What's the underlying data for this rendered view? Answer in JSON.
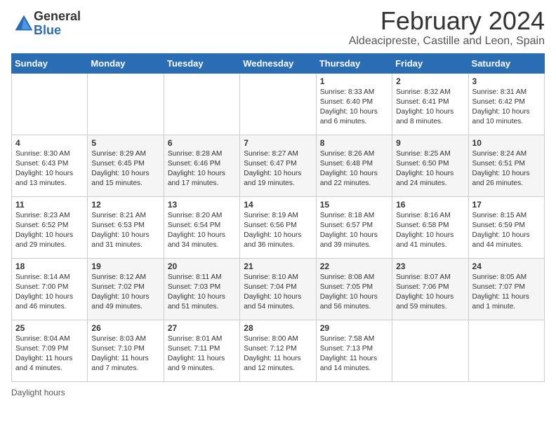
{
  "logo": {
    "general": "General",
    "blue": "Blue"
  },
  "title": {
    "month": "February 2024",
    "location": "Aldeacipreste, Castille and Leon, Spain"
  },
  "days_header": [
    "Sunday",
    "Monday",
    "Tuesday",
    "Wednesday",
    "Thursday",
    "Friday",
    "Saturday"
  ],
  "weeks": [
    [
      {
        "day": "",
        "info": ""
      },
      {
        "day": "",
        "info": ""
      },
      {
        "day": "",
        "info": ""
      },
      {
        "day": "",
        "info": ""
      },
      {
        "day": "1",
        "info": "Sunrise: 8:33 AM\nSunset: 6:40 PM\nDaylight: 10 hours\nand 6 minutes."
      },
      {
        "day": "2",
        "info": "Sunrise: 8:32 AM\nSunset: 6:41 PM\nDaylight: 10 hours\nand 8 minutes."
      },
      {
        "day": "3",
        "info": "Sunrise: 8:31 AM\nSunset: 6:42 PM\nDaylight: 10 hours\nand 10 minutes."
      }
    ],
    [
      {
        "day": "4",
        "info": "Sunrise: 8:30 AM\nSunset: 6:43 PM\nDaylight: 10 hours\nand 13 minutes."
      },
      {
        "day": "5",
        "info": "Sunrise: 8:29 AM\nSunset: 6:45 PM\nDaylight: 10 hours\nand 15 minutes."
      },
      {
        "day": "6",
        "info": "Sunrise: 8:28 AM\nSunset: 6:46 PM\nDaylight: 10 hours\nand 17 minutes."
      },
      {
        "day": "7",
        "info": "Sunrise: 8:27 AM\nSunset: 6:47 PM\nDaylight: 10 hours\nand 19 minutes."
      },
      {
        "day": "8",
        "info": "Sunrise: 8:26 AM\nSunset: 6:48 PM\nDaylight: 10 hours\nand 22 minutes."
      },
      {
        "day": "9",
        "info": "Sunrise: 8:25 AM\nSunset: 6:50 PM\nDaylight: 10 hours\nand 24 minutes."
      },
      {
        "day": "10",
        "info": "Sunrise: 8:24 AM\nSunset: 6:51 PM\nDaylight: 10 hours\nand 26 minutes."
      }
    ],
    [
      {
        "day": "11",
        "info": "Sunrise: 8:23 AM\nSunset: 6:52 PM\nDaylight: 10 hours\nand 29 minutes."
      },
      {
        "day": "12",
        "info": "Sunrise: 8:21 AM\nSunset: 6:53 PM\nDaylight: 10 hours\nand 31 minutes."
      },
      {
        "day": "13",
        "info": "Sunrise: 8:20 AM\nSunset: 6:54 PM\nDaylight: 10 hours\nand 34 minutes."
      },
      {
        "day": "14",
        "info": "Sunrise: 8:19 AM\nSunset: 6:56 PM\nDaylight: 10 hours\nand 36 minutes."
      },
      {
        "day": "15",
        "info": "Sunrise: 8:18 AM\nSunset: 6:57 PM\nDaylight: 10 hours\nand 39 minutes."
      },
      {
        "day": "16",
        "info": "Sunrise: 8:16 AM\nSunset: 6:58 PM\nDaylight: 10 hours\nand 41 minutes."
      },
      {
        "day": "17",
        "info": "Sunrise: 8:15 AM\nSunset: 6:59 PM\nDaylight: 10 hours\nand 44 minutes."
      }
    ],
    [
      {
        "day": "18",
        "info": "Sunrise: 8:14 AM\nSunset: 7:00 PM\nDaylight: 10 hours\nand 46 minutes."
      },
      {
        "day": "19",
        "info": "Sunrise: 8:12 AM\nSunset: 7:02 PM\nDaylight: 10 hours\nand 49 minutes."
      },
      {
        "day": "20",
        "info": "Sunrise: 8:11 AM\nSunset: 7:03 PM\nDaylight: 10 hours\nand 51 minutes."
      },
      {
        "day": "21",
        "info": "Sunrise: 8:10 AM\nSunset: 7:04 PM\nDaylight: 10 hours\nand 54 minutes."
      },
      {
        "day": "22",
        "info": "Sunrise: 8:08 AM\nSunset: 7:05 PM\nDaylight: 10 hours\nand 56 minutes."
      },
      {
        "day": "23",
        "info": "Sunrise: 8:07 AM\nSunset: 7:06 PM\nDaylight: 10 hours\nand 59 minutes."
      },
      {
        "day": "24",
        "info": "Sunrise: 8:05 AM\nSunset: 7:07 PM\nDaylight: 11 hours\nand 1 minute."
      }
    ],
    [
      {
        "day": "25",
        "info": "Sunrise: 8:04 AM\nSunset: 7:09 PM\nDaylight: 11 hours\nand 4 minutes."
      },
      {
        "day": "26",
        "info": "Sunrise: 8:03 AM\nSunset: 7:10 PM\nDaylight: 11 hours\nand 7 minutes."
      },
      {
        "day": "27",
        "info": "Sunrise: 8:01 AM\nSunset: 7:11 PM\nDaylight: 11 hours\nand 9 minutes."
      },
      {
        "day": "28",
        "info": "Sunrise: 8:00 AM\nSunset: 7:12 PM\nDaylight: 11 hours\nand 12 minutes."
      },
      {
        "day": "29",
        "info": "Sunrise: 7:58 AM\nSunset: 7:13 PM\nDaylight: 11 hours\nand 14 minutes."
      },
      {
        "day": "",
        "info": ""
      },
      {
        "day": "",
        "info": ""
      }
    ]
  ],
  "footer": {
    "daylight_hours": "Daylight hours"
  }
}
